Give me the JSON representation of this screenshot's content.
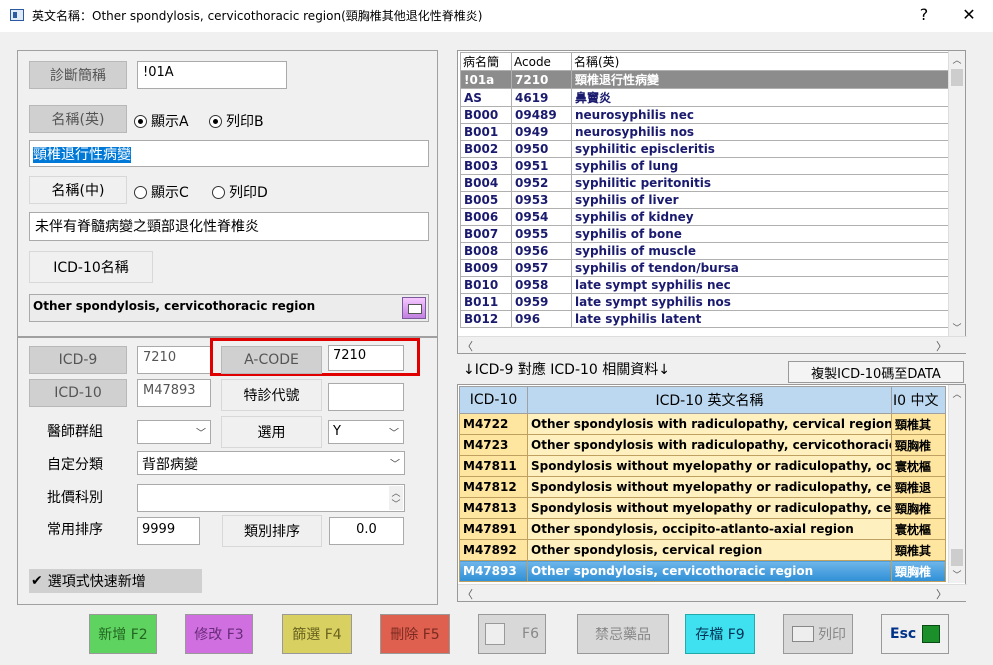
{
  "window": {
    "title": "英文名稱：Other spondylosis, cervicothoracic region(頸胸椎其他退化性脊椎炎)",
    "help_label": "?",
    "close_label": "✕"
  },
  "form": {
    "abbr_button": "診斷簡稱",
    "abbr_value": "!01A",
    "name_en_button": "名稱(英)",
    "radio_show_a": "顯示A",
    "radio_print_b": "列印B",
    "name_en_value": "頸椎退行性病變",
    "name_zh_button": "名稱(中)",
    "radio_show_c": "顯示C",
    "radio_print_d": "列印D",
    "name_zh_value": "未伴有脊髓病變之頸部退化性脊椎炎",
    "icd10_name_button": "ICD-10名稱",
    "icd10_name_value": "Other spondylosis, cervicothoracic region",
    "icd9_button": "ICD-9",
    "icd9_value": "7210",
    "acode_button": "A-CODE",
    "acode_value": "7210",
    "icd10_button": "ICD-10",
    "icd10_value": "M47893",
    "special_code_label": "特診代號",
    "special_code_value": "",
    "doctor_group_label": "醫師群組",
    "doctor_group_value": "",
    "applicable_label": "選用",
    "applicable_value": "Y",
    "custom_category_label": "自定分類",
    "custom_category_value": "背部病變",
    "batch_dept_label": "批價科別",
    "batch_dept_value": "",
    "common_sort_label": "常用排序",
    "common_sort_value": "9999",
    "category_sort_label": "類別排序",
    "category_sort_value": "0.0",
    "quick_add_label": "選項式快速新增"
  },
  "top_grid": {
    "columns": [
      "病名簡",
      "Acode",
      "名稱(英)"
    ],
    "rows": [
      [
        "!01a",
        "7210",
        "頸椎退行性病變"
      ],
      [
        "AS",
        "4619",
        "鼻竇炎"
      ],
      [
        "B000",
        "09489",
        "neurosyphilis nec"
      ],
      [
        "B001",
        "0949",
        "neurosyphilis nos"
      ],
      [
        "B002",
        "0950",
        "syphilitic episcleritis"
      ],
      [
        "B003",
        "0951",
        "syphilis of lung"
      ],
      [
        "B004",
        "0952",
        "syphilitic peritonitis"
      ],
      [
        "B005",
        "0953",
        "syphilis of liver"
      ],
      [
        "B006",
        "0954",
        "syphilis of kidney"
      ],
      [
        "B007",
        "0955",
        "syphilis of bone"
      ],
      [
        "B008",
        "0956",
        "syphilis of muscle"
      ],
      [
        "B009",
        "0957",
        "syphilis of tendon/bursa"
      ],
      [
        "B010",
        "0958",
        "late sympt syphilis nec"
      ],
      [
        "B011",
        "0959",
        "late sympt syphilis nos"
      ],
      [
        "B012",
        "096",
        "late syphilis latent"
      ]
    ]
  },
  "mapping": {
    "caption": "↓ICD-9 對應 ICD-10 相關資料↓",
    "copy_button": "複製ICD-10碼至DATA"
  },
  "bottom_grid": {
    "columns": [
      "ICD-10",
      "ICD-10 英文名稱",
      "I0 中文"
    ],
    "rows": [
      [
        "M4722",
        "Other spondylosis with radiculopathy, cervical region",
        "頸椎其"
      ],
      [
        "M4723",
        "Other spondylosis with radiculopathy, cervicothoracic r",
        "頸胸椎"
      ],
      [
        "M47811",
        "Spondylosis without myelopathy or radiculopathy, occi",
        "寰枕樞"
      ],
      [
        "M47812",
        "Spondylosis without myelopathy or radiculopathy, cerv",
        "頸椎退"
      ],
      [
        "M47813",
        "Spondylosis without myelopathy or radiculopathy, cerv",
        "頸胸椎"
      ],
      [
        "M47891",
        "Other spondylosis, occipito-atlanto-axial region",
        "寰枕樞"
      ],
      [
        "M47892",
        "Other spondylosis, cervical region",
        "頸椎其"
      ],
      [
        "M47893",
        "Other spondylosis, cervicothoracic region",
        "頸胸椎"
      ]
    ]
  },
  "footer": {
    "add": "新增 F2",
    "modify": "修改 F3",
    "filter": "篩選 F4",
    "delete": "刪除 F5",
    "f6": "F6",
    "forbidden_drugs": "禁忌藥品",
    "save": "存檔 F9",
    "print": "列印",
    "esc": "Esc"
  },
  "colors": {
    "highlight_red": "#e00000",
    "selected_row_gray": "#8c8c8c",
    "selected_row_blue": "#2f8fd6",
    "grid_row_yellow": "#fff0bf",
    "add_green": "#5fd35f",
    "modify_purple": "#d070e0",
    "filter_olive": "#d8d060",
    "delete_red": "#e06050",
    "save_cyan": "#3fe0f0"
  }
}
